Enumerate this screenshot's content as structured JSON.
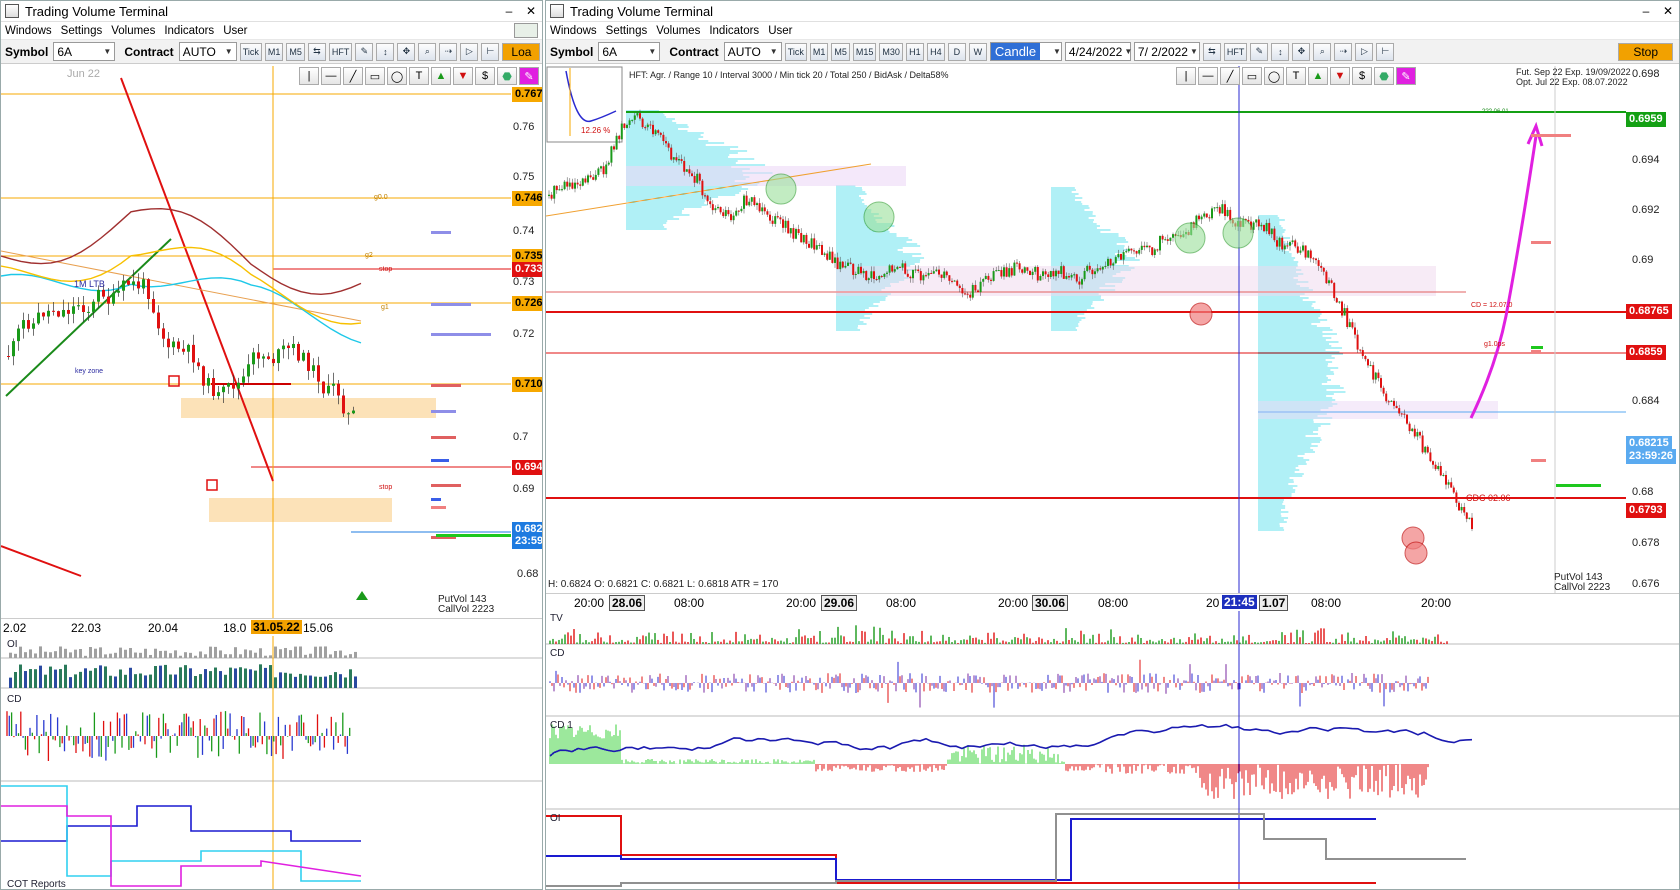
{
  "left": {
    "title": "Trading Volume Terminal",
    "menu": [
      "Windows",
      "Settings",
      "Volumes",
      "Indicators",
      "User"
    ],
    "toolbar": {
      "symbol_label": "Symbol",
      "symbol_value": "6A",
      "contract_label": "Contract",
      "contract_value": "AUTO",
      "intervals": [
        "Tick",
        "M1",
        "M5"
      ],
      "hft_label": "HFT",
      "load_label": "Loa"
    },
    "chart": {
      "month_label": "Jun 22",
      "price_labels": [
        "0.76",
        "0.75",
        "0.74",
        "0.73",
        "0.72",
        "0.7",
        "0.69"
      ],
      "tags": [
        {
          "text": "0.767",
          "color": "#f7a800"
        },
        {
          "text": "0.746",
          "color": "#f7a800"
        },
        {
          "text": "0.735",
          "color": "#f7a800"
        },
        {
          "text": "0.733",
          "color": "#e01010"
        },
        {
          "text": "0.726",
          "color": "#f7a800"
        },
        {
          "text": "0.710",
          "color": "#f7a800"
        },
        {
          "text": "0.694",
          "color": "#e01010"
        },
        {
          "text": "0.682",
          "color": "#1e7be0"
        },
        {
          "text": "23:59",
          "color": "#1e7be0"
        }
      ],
      "bottom_price": "0.68",
      "annotations": {
        "ltb": "1M LTB",
        "key_zone": "key zone",
        "stop1": "stop",
        "stop2": "stop",
        "g0": "g0.0",
        "g1": "g1",
        "g2": "g2"
      },
      "putvol": "PutVol 143",
      "callvol": "CallVol 2223",
      "x_ticks": [
        "2.02",
        "22.03",
        "20.04",
        "18.0",
        "31.05.22",
        "15.06"
      ]
    },
    "panels": {
      "oi": "OI",
      "cd": "CD",
      "cot": "COT Reports"
    }
  },
  "right": {
    "title": "Trading Volume Terminal",
    "menu": [
      "Windows",
      "Settings",
      "Volumes",
      "Indicators",
      "User"
    ],
    "toolbar": {
      "symbol_label": "Symbol",
      "symbol_value": "6A",
      "contract_label": "Contract",
      "contract_value": "AUTO",
      "intervals": [
        "Tick",
        "M1",
        "M5",
        "M15",
        "M30",
        "H1",
        "H4",
        "D",
        "W"
      ],
      "chart_type": "Candle",
      "date_from": "4/24/2022",
      "date_to": "7/ 2/2022",
      "hft_label": "HFT",
      "stop_label": "Stop"
    },
    "chart": {
      "header": "HFT: Agr. / Range 10 / Interval 3000 / Min tick 20 / Total 250 / BidAsk / Delta58%",
      "inset_pct": "12.26 %",
      "exp1": "Fut. Sep 22 Exp. 19/09/2022",
      "exp2": "Opt. Jul 22 Exp. 08.07.2022",
      "price_labels": [
        "0.698",
        "0.694",
        "0.692",
        "0.69",
        "0.688",
        "0.684",
        "0.68",
        "0.678",
        "0.676"
      ],
      "tags": [
        {
          "text": "0.6959",
          "color": "#14a014"
        },
        {
          "text": "0.68765",
          "color": "#e01010"
        },
        {
          "text": "0.6859",
          "color": "#e01010"
        },
        {
          "text": "0.68215",
          "color": "#5aaaf0"
        },
        {
          "text": "23:59:26",
          "color": "#5aaaf0"
        },
        {
          "text": "0.6793",
          "color": "#e01010"
        }
      ],
      "annotations": {
        "cdc": "CDC 02.06",
        "cd_line": "CD = 12.07.0",
        "g1": "g1.0ps",
        "top_small": "??? 06.01"
      },
      "ohlc": "H: 0.6824   O: 0.6821   C: 0.6821   L: 0.6818   ATR = 170",
      "putvol": "PutVol  143",
      "callvol": "CallVol  2223",
      "x_ticks": [
        "20:00",
        "28.06",
        "08:00",
        "20:00",
        "29.06",
        "08:00",
        "20:00",
        "30.06",
        "08:00",
        "20",
        "21:45",
        "1.07",
        "08:00",
        "20:00"
      ]
    },
    "panels": {
      "tv": "TV",
      "cd": "CD",
      "cd1": "CD 1",
      "oi": "OI"
    }
  }
}
